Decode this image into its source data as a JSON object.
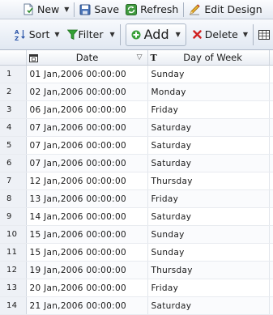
{
  "toolbar1": {
    "new_label": "New",
    "save_label": "Save",
    "refresh_label": "Refresh",
    "edit_design_label": "Edit Design"
  },
  "toolbar2": {
    "sort_label": "Sort",
    "filter_label": "Filter",
    "add_label": "Add",
    "delete_label": "Delete"
  },
  "grid": {
    "columns": [
      "Date",
      "Day of Week"
    ],
    "rows": [
      {
        "num": "1",
        "date": "01 Jan,2006 00:00:00",
        "day": "Sunday"
      },
      {
        "num": "2",
        "date": "02 Jan,2006 00:00:00",
        "day": "Monday"
      },
      {
        "num": "3",
        "date": "06 Jan,2006 00:00:00",
        "day": "Friday"
      },
      {
        "num": "4",
        "date": "07 Jan,2006 00:00:00",
        "day": "Saturday"
      },
      {
        "num": "5",
        "date": "07 Jan,2006 00:00:00",
        "day": "Saturday"
      },
      {
        "num": "6",
        "date": "07 Jan,2006 00:00:00",
        "day": "Saturday"
      },
      {
        "num": "7",
        "date": "12 Jan,2006 00:00:00",
        "day": "Thursday"
      },
      {
        "num": "8",
        "date": "13 Jan,2006 00:00:00",
        "day": "Friday"
      },
      {
        "num": "9",
        "date": "14 Jan,2006 00:00:00",
        "day": "Saturday"
      },
      {
        "num": "10",
        "date": "15 Jan,2006 00:00:00",
        "day": "Sunday"
      },
      {
        "num": "11",
        "date": "15 Jan,2006 00:00:00",
        "day": "Sunday"
      },
      {
        "num": "12",
        "date": "19 Jan,2006 00:00:00",
        "day": "Thursday"
      },
      {
        "num": "13",
        "date": "20 Jan,2006 00:00:00",
        "day": "Friday"
      },
      {
        "num": "14",
        "date": "21 Jan,2006 00:00:00",
        "day": "Saturday"
      }
    ]
  }
}
